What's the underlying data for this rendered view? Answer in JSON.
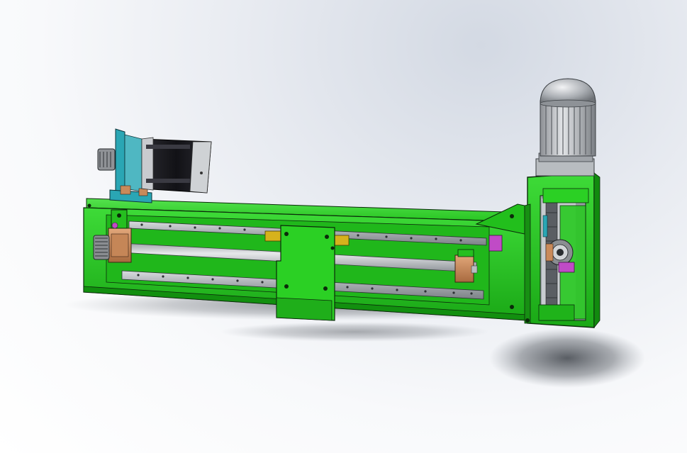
{
  "scene": {
    "description_free": true,
    "palette": {
      "frame_green": "#1fc21a",
      "frame_green_dark": "#118a0e",
      "frame_green_light": "#3edb38",
      "rail_grey": "#a9aeb3",
      "shaft_grey": "#c4c8cc",
      "bearing_copper": "#c98a5a",
      "bracket_cyan": "#2aa6b4",
      "motor_black": "#1b1b1f",
      "motor_silver": "#c9cbcf",
      "accent_magenta": "#c04bc6",
      "accent_yellow": "#d6b21c",
      "outline": "#0b2a0a"
    },
    "components": [
      "base-frame",
      "linear-rail-top",
      "linear-rail-bottom",
      "lead-screw",
      "carriage-block",
      "bearing-block-left",
      "bearing-block-right",
      "stepper-motor",
      "motor-mount-bracket",
      "gear-motor",
      "end-gearbox-plate",
      "drive-pulley"
    ]
  }
}
